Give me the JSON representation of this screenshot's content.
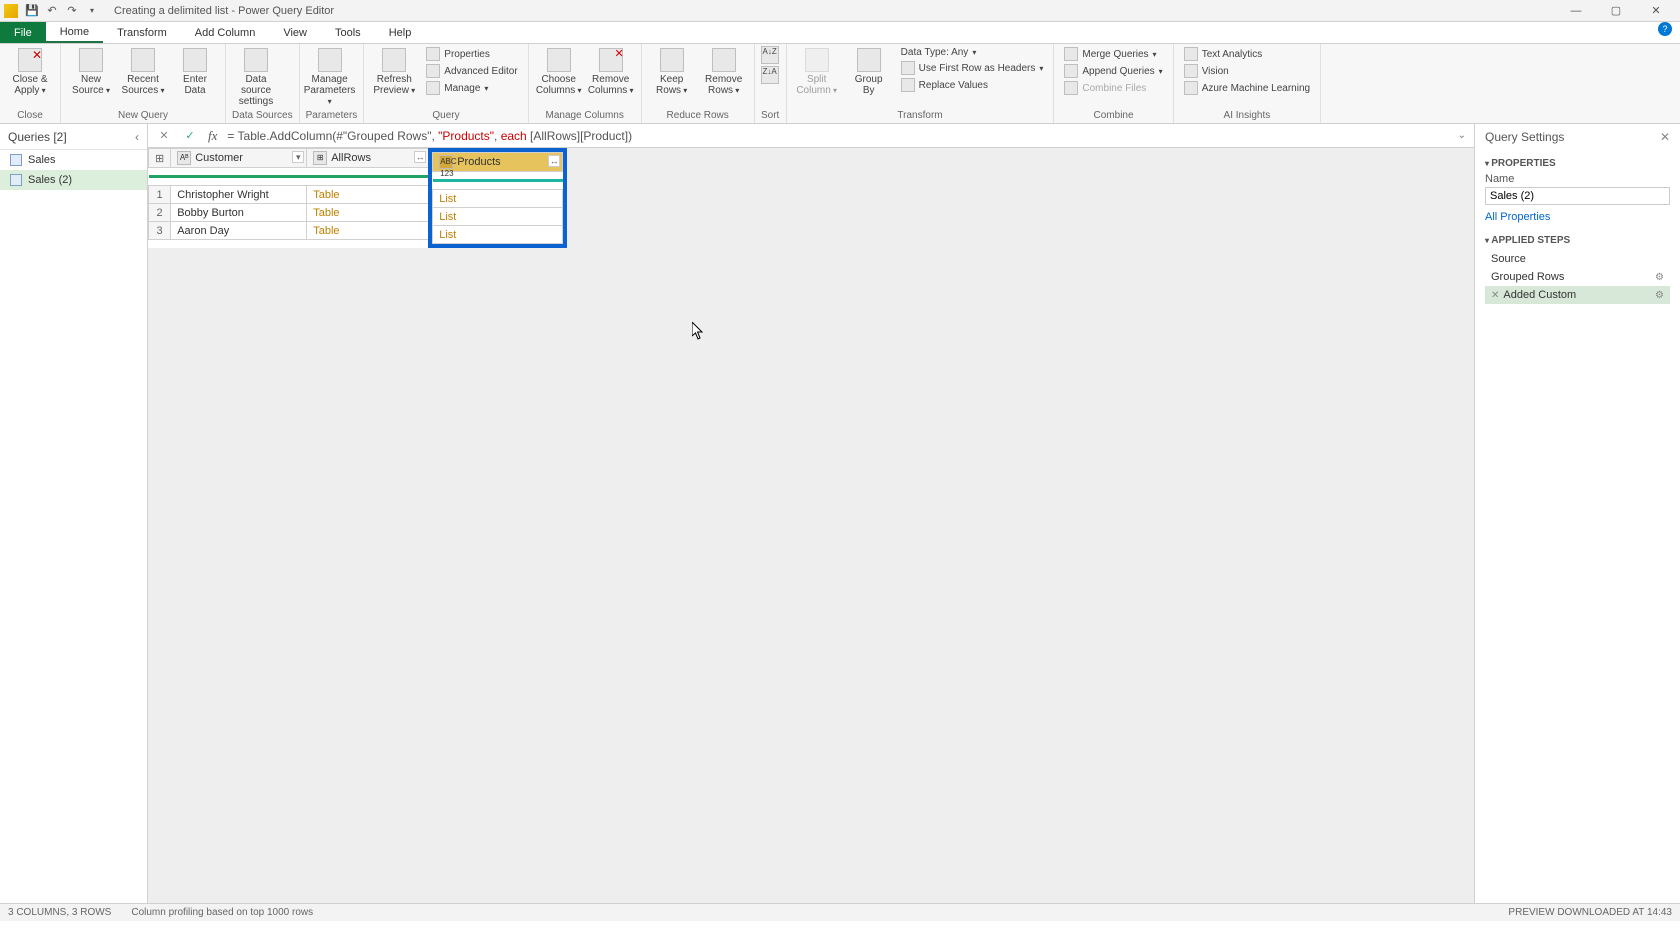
{
  "titlebar": {
    "title": "Creating a delimited list - Power Query Editor"
  },
  "tabs": {
    "file": "File",
    "home": "Home",
    "transform": "Transform",
    "addcolumn": "Add Column",
    "view": "View",
    "tools": "Tools",
    "help": "Help"
  },
  "ribbon": {
    "close": {
      "closeapply": "Close &\nApply",
      "group": "Close"
    },
    "newquery": {
      "newsource": "New\nSource",
      "recentsources": "Recent\nSources",
      "enterdata": "Enter\nData",
      "group": "New Query"
    },
    "datasources": {
      "settings": "Data source\nsettings",
      "group": "Data Sources"
    },
    "parameters": {
      "manage": "Manage\nParameters",
      "group": "Parameters"
    },
    "query": {
      "refresh": "Refresh\nPreview",
      "properties": "Properties",
      "advanced": "Advanced Editor",
      "managebtn": "Manage",
      "group": "Query"
    },
    "managecols": {
      "choose": "Choose\nColumns",
      "remove": "Remove\nColumns",
      "group": "Manage Columns"
    },
    "reducerows": {
      "keep": "Keep\nRows",
      "removerows": "Remove\nRows",
      "group": "Reduce Rows"
    },
    "sort": {
      "group": "Sort"
    },
    "transform": {
      "split": "Split\nColumn",
      "groupby": "Group\nBy",
      "datatype": "Data Type: Any",
      "firstrow": "Use First Row as Headers",
      "replace": "Replace Values",
      "group": "Transform"
    },
    "combine": {
      "merge": "Merge Queries",
      "append": "Append Queries",
      "combinefiles": "Combine Files",
      "group": "Combine"
    },
    "ai": {
      "textanalytics": "Text Analytics",
      "vision": "Vision",
      "azureml": "Azure Machine Learning",
      "group": "AI Insights"
    }
  },
  "formula": {
    "prefix": "= Table.AddColumn(#\"Grouped Rows\", ",
    "string": "\"Products\"",
    "mid": ", ",
    "each": "each",
    "suffix": " [AllRows][Product])"
  },
  "queries": {
    "header": "Queries [2]",
    "items": [
      "Sales",
      "Sales (2)"
    ]
  },
  "columns": {
    "customer": "Customer",
    "allrows": "AllRows",
    "products": "Products"
  },
  "rows": [
    {
      "n": "1",
      "customer": "Christopher Wright",
      "allrows": "Table",
      "products": "List"
    },
    {
      "n": "2",
      "customer": "Bobby Burton",
      "allrows": "Table",
      "products": "List"
    },
    {
      "n": "3",
      "customer": "Aaron Day",
      "allrows": "Table",
      "products": "List"
    }
  ],
  "settings": {
    "title": "Query Settings",
    "properties": "PROPERTIES",
    "namelabel": "Name",
    "namevalue": "Sales (2)",
    "allprops": "All Properties",
    "appliedsteps": "APPLIED STEPS",
    "steps": [
      "Source",
      "Grouped Rows",
      "Added Custom"
    ]
  },
  "statusbar": {
    "left1": "3 COLUMNS, 3 ROWS",
    "left2": "Column profiling based on top 1000 rows",
    "right": "PREVIEW DOWNLOADED AT 14:43"
  }
}
